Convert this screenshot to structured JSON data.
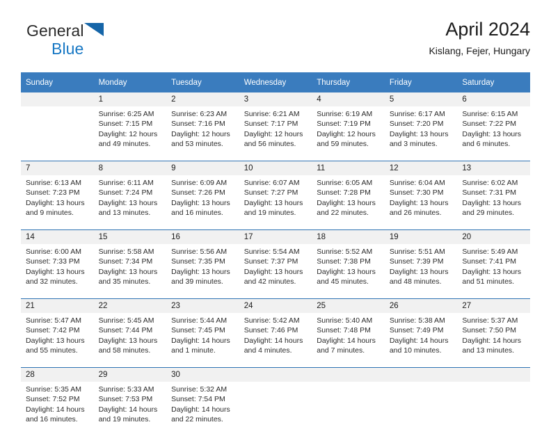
{
  "brand": {
    "name_part1": "General",
    "name_part2": "Blue",
    "logo_icon": "blue-triangle-flag-icon"
  },
  "header": {
    "title": "April 2024",
    "subtitle": "Kislang, Fejer, Hungary"
  },
  "colors": {
    "header_bar": "#3a7cbe",
    "row_divider": "#2d72b3",
    "daynum_band": "#f1f1f1",
    "brand_blue": "#1878c4",
    "text": "#1a1a1a"
  },
  "weekdays": [
    "Sunday",
    "Monday",
    "Tuesday",
    "Wednesday",
    "Thursday",
    "Friday",
    "Saturday"
  ],
  "weeks": [
    [
      {
        "day": "",
        "sunrise": "",
        "sunset": "",
        "daylight1": "",
        "daylight2": ""
      },
      {
        "day": "1",
        "sunrise": "Sunrise: 6:25 AM",
        "sunset": "Sunset: 7:15 PM",
        "daylight1": "Daylight: 12 hours",
        "daylight2": "and 49 minutes."
      },
      {
        "day": "2",
        "sunrise": "Sunrise: 6:23 AM",
        "sunset": "Sunset: 7:16 PM",
        "daylight1": "Daylight: 12 hours",
        "daylight2": "and 53 minutes."
      },
      {
        "day": "3",
        "sunrise": "Sunrise: 6:21 AM",
        "sunset": "Sunset: 7:17 PM",
        "daylight1": "Daylight: 12 hours",
        "daylight2": "and 56 minutes."
      },
      {
        "day": "4",
        "sunrise": "Sunrise: 6:19 AM",
        "sunset": "Sunset: 7:19 PM",
        "daylight1": "Daylight: 12 hours",
        "daylight2": "and 59 minutes."
      },
      {
        "day": "5",
        "sunrise": "Sunrise: 6:17 AM",
        "sunset": "Sunset: 7:20 PM",
        "daylight1": "Daylight: 13 hours",
        "daylight2": "and 3 minutes."
      },
      {
        "day": "6",
        "sunrise": "Sunrise: 6:15 AM",
        "sunset": "Sunset: 7:22 PM",
        "daylight1": "Daylight: 13 hours",
        "daylight2": "and 6 minutes."
      }
    ],
    [
      {
        "day": "7",
        "sunrise": "Sunrise: 6:13 AM",
        "sunset": "Sunset: 7:23 PM",
        "daylight1": "Daylight: 13 hours",
        "daylight2": "and 9 minutes."
      },
      {
        "day": "8",
        "sunrise": "Sunrise: 6:11 AM",
        "sunset": "Sunset: 7:24 PM",
        "daylight1": "Daylight: 13 hours",
        "daylight2": "and 13 minutes."
      },
      {
        "day": "9",
        "sunrise": "Sunrise: 6:09 AM",
        "sunset": "Sunset: 7:26 PM",
        "daylight1": "Daylight: 13 hours",
        "daylight2": "and 16 minutes."
      },
      {
        "day": "10",
        "sunrise": "Sunrise: 6:07 AM",
        "sunset": "Sunset: 7:27 PM",
        "daylight1": "Daylight: 13 hours",
        "daylight2": "and 19 minutes."
      },
      {
        "day": "11",
        "sunrise": "Sunrise: 6:05 AM",
        "sunset": "Sunset: 7:28 PM",
        "daylight1": "Daylight: 13 hours",
        "daylight2": "and 22 minutes."
      },
      {
        "day": "12",
        "sunrise": "Sunrise: 6:04 AM",
        "sunset": "Sunset: 7:30 PM",
        "daylight1": "Daylight: 13 hours",
        "daylight2": "and 26 minutes."
      },
      {
        "day": "13",
        "sunrise": "Sunrise: 6:02 AM",
        "sunset": "Sunset: 7:31 PM",
        "daylight1": "Daylight: 13 hours",
        "daylight2": "and 29 minutes."
      }
    ],
    [
      {
        "day": "14",
        "sunrise": "Sunrise: 6:00 AM",
        "sunset": "Sunset: 7:33 PM",
        "daylight1": "Daylight: 13 hours",
        "daylight2": "and 32 minutes."
      },
      {
        "day": "15",
        "sunrise": "Sunrise: 5:58 AM",
        "sunset": "Sunset: 7:34 PM",
        "daylight1": "Daylight: 13 hours",
        "daylight2": "and 35 minutes."
      },
      {
        "day": "16",
        "sunrise": "Sunrise: 5:56 AM",
        "sunset": "Sunset: 7:35 PM",
        "daylight1": "Daylight: 13 hours",
        "daylight2": "and 39 minutes."
      },
      {
        "day": "17",
        "sunrise": "Sunrise: 5:54 AM",
        "sunset": "Sunset: 7:37 PM",
        "daylight1": "Daylight: 13 hours",
        "daylight2": "and 42 minutes."
      },
      {
        "day": "18",
        "sunrise": "Sunrise: 5:52 AM",
        "sunset": "Sunset: 7:38 PM",
        "daylight1": "Daylight: 13 hours",
        "daylight2": "and 45 minutes."
      },
      {
        "day": "19",
        "sunrise": "Sunrise: 5:51 AM",
        "sunset": "Sunset: 7:39 PM",
        "daylight1": "Daylight: 13 hours",
        "daylight2": "and 48 minutes."
      },
      {
        "day": "20",
        "sunrise": "Sunrise: 5:49 AM",
        "sunset": "Sunset: 7:41 PM",
        "daylight1": "Daylight: 13 hours",
        "daylight2": "and 51 minutes."
      }
    ],
    [
      {
        "day": "21",
        "sunrise": "Sunrise: 5:47 AM",
        "sunset": "Sunset: 7:42 PM",
        "daylight1": "Daylight: 13 hours",
        "daylight2": "and 55 minutes."
      },
      {
        "day": "22",
        "sunrise": "Sunrise: 5:45 AM",
        "sunset": "Sunset: 7:44 PM",
        "daylight1": "Daylight: 13 hours",
        "daylight2": "and 58 minutes."
      },
      {
        "day": "23",
        "sunrise": "Sunrise: 5:44 AM",
        "sunset": "Sunset: 7:45 PM",
        "daylight1": "Daylight: 14 hours",
        "daylight2": "and 1 minute."
      },
      {
        "day": "24",
        "sunrise": "Sunrise: 5:42 AM",
        "sunset": "Sunset: 7:46 PM",
        "daylight1": "Daylight: 14 hours",
        "daylight2": "and 4 minutes."
      },
      {
        "day": "25",
        "sunrise": "Sunrise: 5:40 AM",
        "sunset": "Sunset: 7:48 PM",
        "daylight1": "Daylight: 14 hours",
        "daylight2": "and 7 minutes."
      },
      {
        "day": "26",
        "sunrise": "Sunrise: 5:38 AM",
        "sunset": "Sunset: 7:49 PM",
        "daylight1": "Daylight: 14 hours",
        "daylight2": "and 10 minutes."
      },
      {
        "day": "27",
        "sunrise": "Sunrise: 5:37 AM",
        "sunset": "Sunset: 7:50 PM",
        "daylight1": "Daylight: 14 hours",
        "daylight2": "and 13 minutes."
      }
    ],
    [
      {
        "day": "28",
        "sunrise": "Sunrise: 5:35 AM",
        "sunset": "Sunset: 7:52 PM",
        "daylight1": "Daylight: 14 hours",
        "daylight2": "and 16 minutes."
      },
      {
        "day": "29",
        "sunrise": "Sunrise: 5:33 AM",
        "sunset": "Sunset: 7:53 PM",
        "daylight1": "Daylight: 14 hours",
        "daylight2": "and 19 minutes."
      },
      {
        "day": "30",
        "sunrise": "Sunrise: 5:32 AM",
        "sunset": "Sunset: 7:54 PM",
        "daylight1": "Daylight: 14 hours",
        "daylight2": "and 22 minutes."
      },
      {
        "day": "",
        "sunrise": "",
        "sunset": "",
        "daylight1": "",
        "daylight2": ""
      },
      {
        "day": "",
        "sunrise": "",
        "sunset": "",
        "daylight1": "",
        "daylight2": ""
      },
      {
        "day": "",
        "sunrise": "",
        "sunset": "",
        "daylight1": "",
        "daylight2": ""
      },
      {
        "day": "",
        "sunrise": "",
        "sunset": "",
        "daylight1": "",
        "daylight2": ""
      }
    ]
  ]
}
